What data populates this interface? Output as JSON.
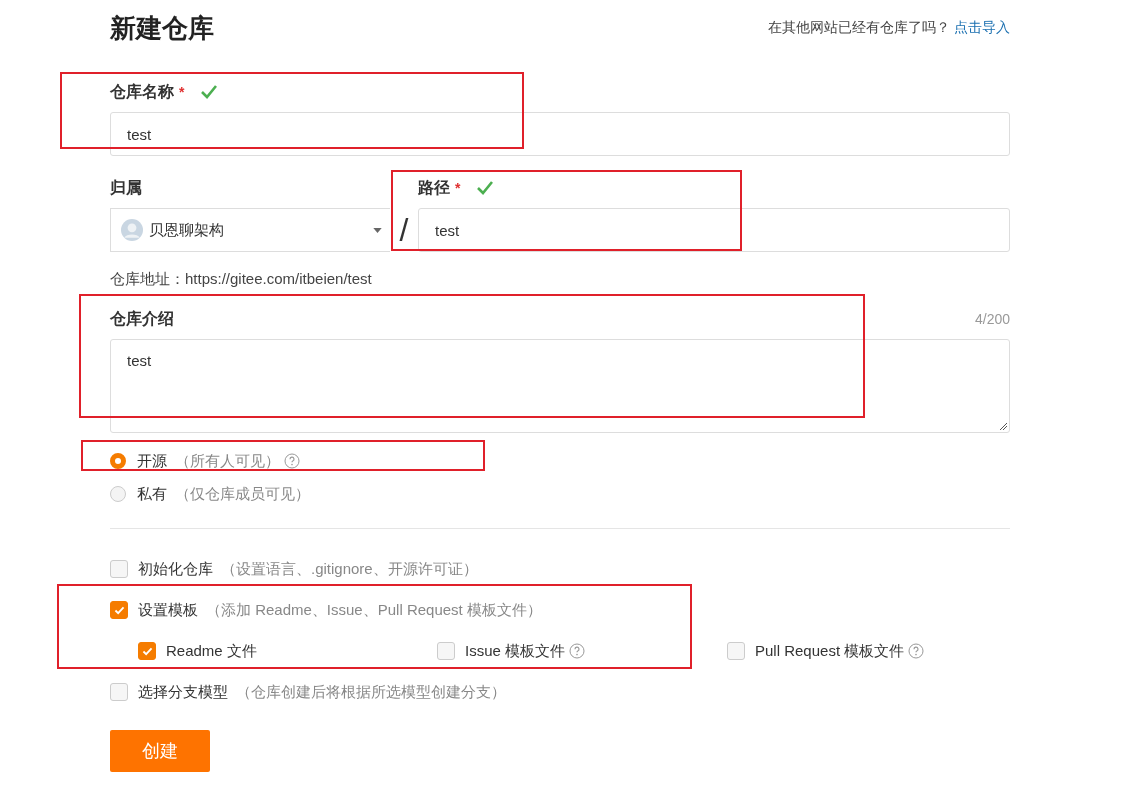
{
  "page_title": "新建仓库",
  "import_prompt": {
    "text": "在其他网站已经有仓库了吗？",
    "link": "点击导入"
  },
  "name_field": {
    "label": "仓库名称",
    "required_mark": "*",
    "valid": true,
    "value": "test"
  },
  "owner_field": {
    "label": "归属",
    "value": "贝恩聊架构"
  },
  "separator": "/",
  "path_field": {
    "label": "路径",
    "required_mark": "*",
    "valid": true,
    "value": "test"
  },
  "repo_address": "仓库地址：https://gitee.com/itbeien/test",
  "description_field": {
    "label": "仓库介绍",
    "counter": "4/200",
    "value": "test"
  },
  "visibility": [
    {
      "label": "开源",
      "hint": "（所有人可见）",
      "help": true,
      "selected": true
    },
    {
      "label": "私有",
      "hint": "（仅仓库成员可见）",
      "help": false,
      "selected": false
    }
  ],
  "options": [
    {
      "label": "初始化仓库",
      "hint": "（设置语言、.gitignore、开源许可证）",
      "checked": false
    },
    {
      "label": "设置模板",
      "hint": "（添加 Readme、Issue、Pull Request 模板文件）",
      "checked": true,
      "children": [
        {
          "label": "Readme 文件",
          "help": false,
          "checked": true
        },
        {
          "label": "Issue 模板文件",
          "help": true,
          "checked": false
        },
        {
          "label": "Pull Request 模板文件",
          "help": true,
          "checked": false
        }
      ]
    },
    {
      "label": "选择分支模型",
      "hint": "（仓库创建后将根据所选模型创建分支）",
      "checked": false
    }
  ],
  "create_button": "创建"
}
